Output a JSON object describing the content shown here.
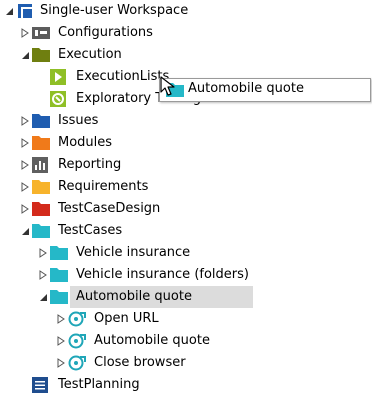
{
  "tree": {
    "root": {
      "label": "Single-user Workspace"
    },
    "configurations": {
      "label": "Configurations"
    },
    "execution": {
      "label": "Execution",
      "children": {
        "execution_lists": {
          "label": "ExecutionLists"
        },
        "exploratory_testing": {
          "label": "Exploratory Testing"
        }
      }
    },
    "issues": {
      "label": "Issues"
    },
    "modules": {
      "label": "Modules"
    },
    "reporting": {
      "label": "Reporting"
    },
    "requirements": {
      "label": "Requirements"
    },
    "testcasedesign": {
      "label": "TestCaseDesign"
    },
    "testcases": {
      "label": "TestCases",
      "children": {
        "vehicle_insurance": {
          "label": "Vehicle insurance"
        },
        "vehicle_insurance_folders": {
          "label": "Vehicle insurance (folders)"
        },
        "automobile_quote": {
          "label": "Automobile quote",
          "children": {
            "open_url": {
              "label": "Open URL"
            },
            "automobile_quote_step": {
              "label": "Automobile quote"
            },
            "close_browser": {
              "label": "Close browser"
            }
          }
        }
      }
    },
    "testplanning": {
      "label": "TestPlanning"
    }
  },
  "drag_preview": {
    "label": "Automobile quote"
  },
  "colors": {
    "execution_folder": "#6f7f10",
    "issues_folder": "#1f5db0",
    "modules_folder": "#f07a1a",
    "reporting_icon": "#5f5f5f",
    "requirements_folder": "#f7b32b",
    "testcasedesign_folder": "#d32a1b",
    "testcases_folder": "#25b8c8",
    "testplanning_icon": "#1f4d8e",
    "selection_bg": "#dcdcdc"
  },
  "icons": {
    "root": "workspace-icon",
    "configurations": "configurations-icon",
    "folder": "folder-icon",
    "execution_list": "execution-list-icon",
    "exploratory": "exploratory-testing-icon",
    "reporting": "reporting-icon",
    "testcase": "testcase-icon",
    "testplanning": "testplanning-icon"
  }
}
